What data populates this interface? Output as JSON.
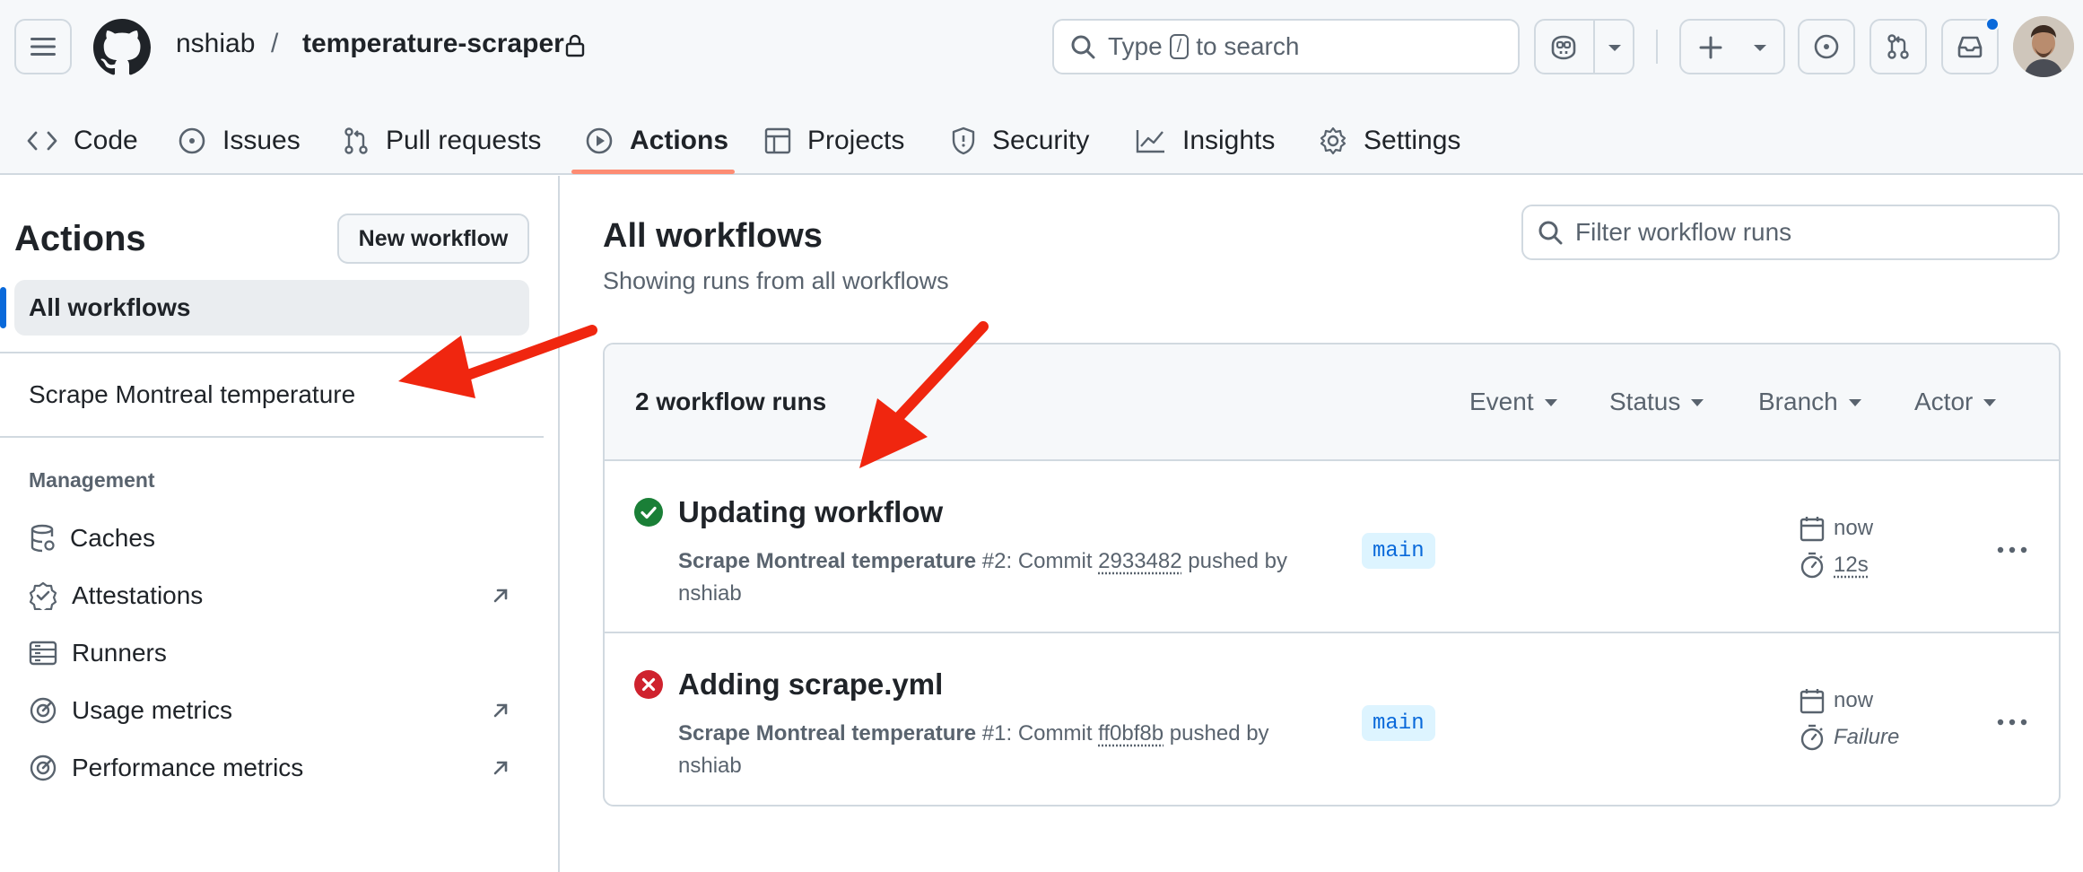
{
  "header": {
    "owner": "nshiab",
    "separator": "/",
    "repo": "temperature-scraper",
    "search": {
      "prefix": "Type",
      "key": "/",
      "suffix": "to search"
    }
  },
  "nav_tabs": [
    {
      "label": "Code",
      "icon": "code-icon"
    },
    {
      "label": "Issues",
      "icon": "issue-icon"
    },
    {
      "label": "Pull requests",
      "icon": "pull-request-icon"
    },
    {
      "label": "Actions",
      "icon": "play-icon",
      "active": true
    },
    {
      "label": "Projects",
      "icon": "table-icon"
    },
    {
      "label": "Security",
      "icon": "shield-icon"
    },
    {
      "label": "Insights",
      "icon": "graph-icon"
    },
    {
      "label": "Settings",
      "icon": "gear-icon"
    }
  ],
  "sidebar": {
    "title": "Actions",
    "new_workflow_label": "New workflow",
    "all_workflows_label": "All workflows",
    "workflows": [
      "Scrape Montreal temperature"
    ],
    "management_heading": "Management",
    "management_items": [
      {
        "label": "Caches",
        "icon": "database-icon",
        "external": false
      },
      {
        "label": "Attestations",
        "icon": "verified-icon",
        "external": true
      },
      {
        "label": "Runners",
        "icon": "server-icon",
        "external": false
      },
      {
        "label": "Usage metrics",
        "icon": "meter-icon",
        "external": true
      },
      {
        "label": "Performance metrics",
        "icon": "meter-icon",
        "external": true
      }
    ]
  },
  "main": {
    "title": "All workflows",
    "subtitle": "Showing runs from all workflows",
    "filter_placeholder": "Filter workflow runs",
    "runs_count": "2 workflow runs",
    "filters": [
      "Event",
      "Status",
      "Branch",
      "Actor"
    ],
    "runs": [
      {
        "title": "Updating workflow",
        "status": "success",
        "workflow": "Scrape Montreal temperature",
        "number": "#2",
        "commit_prefix": ": Commit",
        "sha": "2933482",
        "pushed_by": "pushed by",
        "actor": "nshiab",
        "branch": "main",
        "when": "now",
        "duration": "12s"
      },
      {
        "title": "Adding scrape.yml",
        "status": "failure",
        "workflow": "Scrape Montreal temperature",
        "number": "#1",
        "commit_prefix": ": Commit",
        "sha": "ff0bf8b",
        "pushed_by": "pushed by",
        "actor": "nshiab",
        "branch": "main",
        "when": "now",
        "duration": "Failure"
      }
    ]
  },
  "colors": {
    "accent": "#0969da",
    "success": "#1a7f37",
    "failure": "#cf222e",
    "tab_underline": "#fd8c73",
    "annotation_arrow": "#f0260f"
  }
}
